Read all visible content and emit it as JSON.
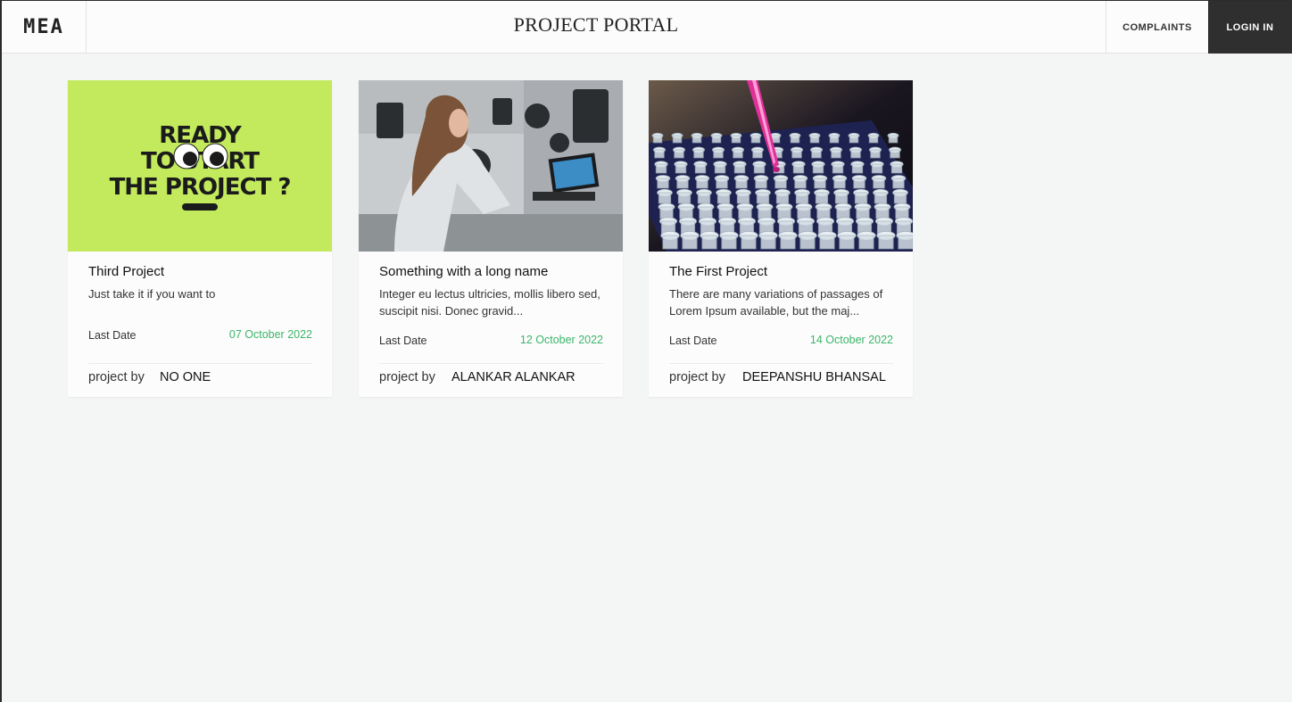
{
  "header": {
    "logo": "MEA",
    "title": "PROJECT PORTAL",
    "complaints_label": "COMPLAINTS",
    "login_label": "LOGIN IN"
  },
  "projects": [
    {
      "image_text_line1": "READY",
      "image_text_line2": "TO START",
      "image_text_line3": "THE PROJECT ?",
      "title": "Third Project",
      "description": "Just take it if you want to",
      "last_date_label": "Last Date",
      "last_date": "07 October 2022",
      "project_by_label": "project by",
      "project_by": "NO ONE"
    },
    {
      "title": "Something with a long name",
      "description": "Integer eu lectus ultricies, mollis libero sed, suscipit nisi. Donec gravid...",
      "last_date_label": "Last Date",
      "last_date": "12 October 2022",
      "project_by_label": "project by",
      "project_by": "ALANKAR ALANKAR"
    },
    {
      "title": "The First Project",
      "description": "There are many variations of passages of Lorem Ipsum available, but the maj...",
      "last_date_label": "Last Date",
      "last_date": "14 October 2022",
      "project_by_label": "project by",
      "project_by": "DEEPANSHU BHANSAL"
    }
  ],
  "colors": {
    "accent_green": "#3cb56a",
    "login_bg": "#2f2f2f",
    "lime": "#c2ea5c",
    "pink": "#e0309a"
  }
}
